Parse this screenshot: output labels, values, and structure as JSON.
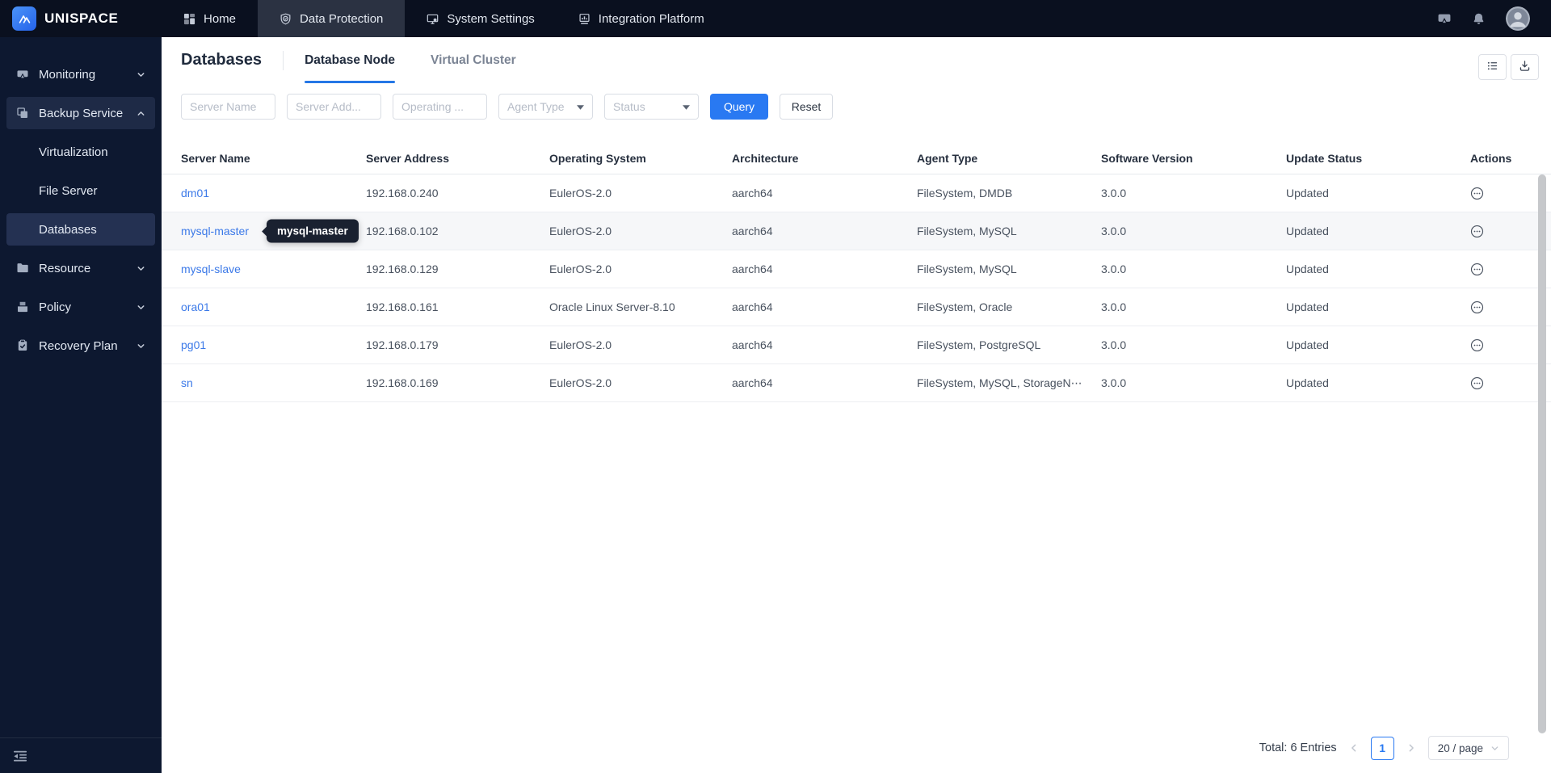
{
  "topbar": {
    "brand": "UNISPACE",
    "nav": [
      {
        "label": "Home",
        "icon": "grid-icon",
        "active": false
      },
      {
        "label": "Data Protection",
        "icon": "shield-check-icon",
        "active": true
      },
      {
        "label": "System Settings",
        "icon": "monitor-gear-icon",
        "active": false
      },
      {
        "label": "Integration Platform",
        "icon": "chart-box-icon",
        "active": false
      }
    ],
    "actions": [
      {
        "icon": "screen-share-icon"
      },
      {
        "icon": "bell-icon"
      },
      {
        "icon": "avatar"
      }
    ]
  },
  "sidebar": {
    "items": [
      {
        "label": "Monitoring",
        "icon": "screencast-icon",
        "chevron": "down",
        "active": false
      },
      {
        "label": "Backup Service",
        "icon": "copy-icon",
        "chevron": "up",
        "active": true
      },
      {
        "label": "Virtualization",
        "child": true,
        "selected": false
      },
      {
        "label": "File Server",
        "child": true,
        "selected": false
      },
      {
        "label": "Databases",
        "child": true,
        "selected": true
      },
      {
        "label": "Resource",
        "icon": "folder-icon",
        "chevron": "down",
        "active": false
      },
      {
        "label": "Policy",
        "icon": "archive-icon",
        "chevron": "down",
        "active": false
      },
      {
        "label": "Recovery Plan",
        "icon": "clipboard-check-icon",
        "chevron": "down",
        "active": false
      }
    ],
    "footer_icon": "collapse-sidebar-icon"
  },
  "page": {
    "title": "Databases",
    "tabs": [
      {
        "label": "Database Node",
        "active": true
      },
      {
        "label": "Virtual Cluster",
        "active": false
      }
    ],
    "toolbar": [
      {
        "icon": "list-icon"
      },
      {
        "icon": "download-icon"
      }
    ],
    "filters": {
      "server_name": "Server Name",
      "server_address": "Server Add...",
      "operating_system": "Operating ...",
      "agent_type": "Agent Type",
      "status": "Status",
      "query_label": "Query",
      "reset_label": "Reset"
    },
    "table": {
      "columns": [
        "Server Name",
        "Server Address",
        "Operating System",
        "Architecture",
        "Agent Type",
        "Software Version",
        "Update Status",
        "Actions"
      ],
      "row_action_icon": "circle-ellipsis-icon",
      "rows": [
        {
          "name": "dm01",
          "address": "192.168.0.240",
          "os": "EulerOS-2.0",
          "arch": "aarch64",
          "agent": "FileSystem, DMDB",
          "version": "3.0.0",
          "status": "Updated"
        },
        {
          "name": "mysql-master",
          "address": "192.168.0.102",
          "os": "EulerOS-2.0",
          "arch": "aarch64",
          "agent": "FileSystem, MySQL",
          "version": "3.0.0",
          "status": "Updated",
          "tooltip": "mysql-master",
          "hovered": true
        },
        {
          "name": "mysql-slave",
          "address": "192.168.0.129",
          "os": "EulerOS-2.0",
          "arch": "aarch64",
          "agent": "FileSystem, MySQL",
          "version": "3.0.0",
          "status": "Updated"
        },
        {
          "name": "ora01",
          "address": "192.168.0.161",
          "os": "Oracle Linux Server-8.10",
          "arch": "aarch64",
          "agent": "FileSystem, Oracle",
          "version": "3.0.0",
          "status": "Updated"
        },
        {
          "name": "pg01",
          "address": "192.168.0.179",
          "os": "EulerOS-2.0",
          "arch": "aarch64",
          "agent": "FileSystem, PostgreSQL",
          "version": "3.0.0",
          "status": "Updated"
        },
        {
          "name": "sn",
          "address": "192.168.0.169",
          "os": "EulerOS-2.0",
          "arch": "aarch64",
          "agent": "FileSystem, MySQL, StorageN⋯",
          "version": "3.0.0",
          "status": "Updated"
        }
      ]
    },
    "pagination": {
      "total": "Total: 6 Entries",
      "current_page": "1",
      "page_size": "20 / page"
    }
  },
  "colors": {
    "topbar_bg": "#0a101f",
    "sidebar_bg": "#0d1830",
    "active_top_tab_bg": "#2b3242",
    "accent_blue": "#2979f2",
    "link_blue": "#3b79e8",
    "tab_underline": "#2577e6",
    "tooltip_bg": "#1a2130"
  }
}
